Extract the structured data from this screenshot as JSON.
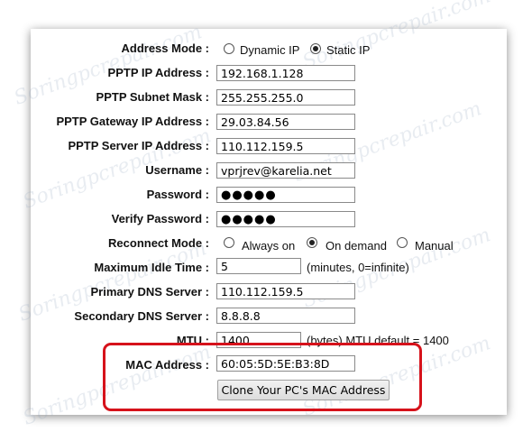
{
  "watermark": "Soringpcrepair.com",
  "form": {
    "address_mode": {
      "label": "Address Mode :",
      "options": [
        "Dynamic IP",
        "Static IP"
      ],
      "selected": 1
    },
    "pptp_ip": {
      "label": "PPTP IP Address :",
      "value": "192.168.1.128"
    },
    "subnet": {
      "label": "PPTP Subnet Mask :",
      "value": "255.255.255.0"
    },
    "gateway": {
      "label": "PPTP Gateway IP Address :",
      "value": "29.03.84.56"
    },
    "server_ip": {
      "label": "PPTP Server IP Address :",
      "value": "110.112.159.5"
    },
    "username": {
      "label": "Username :",
      "value": "vprjrev@karelia.net"
    },
    "password": {
      "label": "Password :",
      "value": "●●●●●"
    },
    "verify": {
      "label": "Verify Password :",
      "value": "●●●●●"
    },
    "reconnect": {
      "label": "Reconnect Mode :",
      "options": [
        "Always on",
        "On demand",
        "Manual"
      ],
      "selected": 1
    },
    "idle": {
      "label": "Maximum Idle Time :",
      "value": "5",
      "note": "(minutes, 0=infinite)"
    },
    "dns1": {
      "label": "Primary DNS Server :",
      "value": "110.112.159.5"
    },
    "dns2": {
      "label": "Secondary DNS Server :",
      "value": "8.8.8.8"
    },
    "mtu": {
      "label": "MTU :",
      "value": "1400",
      "note": "(bytes) MTU default = 1400"
    },
    "mac": {
      "label": "MAC Address :",
      "value": "60:05:5D:5E:B3:8D"
    },
    "clone_button": "Clone Your PC's MAC Address"
  },
  "colors": {
    "highlight": "#d6121b"
  }
}
